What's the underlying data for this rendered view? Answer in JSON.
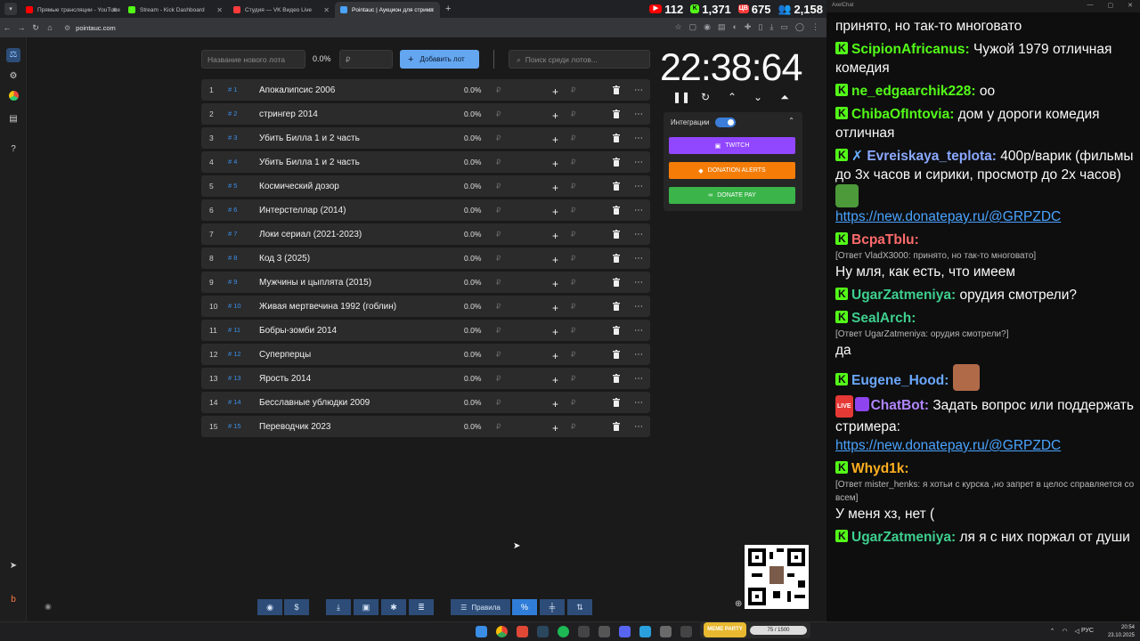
{
  "browser": {
    "tabs": [
      {
        "title": "Прямые трансляции - YouTube",
        "color": "#ff0000"
      },
      {
        "title": "Stream - Kick Dashboard",
        "color": "#53fc18"
      },
      {
        "title": "Студия — VK Видео Live",
        "color": "#ff3b3b"
      },
      {
        "title": "Pointauc | Аукцион для стрима",
        "color": "#4aa3ff"
      }
    ],
    "url": "pointauc.com",
    "viewer_stats": [
      {
        "platform": "youtube",
        "icon": "youtube-icon",
        "count": "112",
        "color": "#ff0000"
      },
      {
        "platform": "kick",
        "icon": "kick-icon",
        "count": "1,371",
        "color": "#53fc18"
      },
      {
        "platform": "vk",
        "icon": "vk-live-icon",
        "count": "675",
        "color": "#ff3b3b"
      },
      {
        "platform": "total",
        "icon": "users-icon",
        "count": "2,158",
        "color": "#4aa3ff"
      }
    ],
    "chat_window_title": "AxelChat"
  },
  "auction": {
    "new_lot_placeholder": "Название нового лота",
    "percent": "0.0%",
    "amount_placeholder": "₽",
    "add_label": "Добавить лот",
    "search_placeholder": "Поиск среди лотов...",
    "lots": [
      {
        "n": "1",
        "id": "# 1",
        "name": "Апокалипсис 2006",
        "pct": "0.0%"
      },
      {
        "n": "2",
        "id": "# 2",
        "name": "стрингер 2014",
        "pct": "0.0%"
      },
      {
        "n": "3",
        "id": "# 3",
        "name": "Убить Билла 1 и 2 часть",
        "pct": "0.0%"
      },
      {
        "n": "4",
        "id": "# 4",
        "name": "Убить Билла 1 и 2 часть",
        "pct": "0.0%"
      },
      {
        "n": "5",
        "id": "# 5",
        "name": "Космический дозор",
        "pct": "0.0%"
      },
      {
        "n": "6",
        "id": "# 6",
        "name": "Интерстеллар (2014)",
        "pct": "0.0%"
      },
      {
        "n": "7",
        "id": "# 7",
        "name": "Локи сериал (2021-2023)",
        "pct": "0.0%"
      },
      {
        "n": "8",
        "id": "# 8",
        "name": "Код 3 (2025)",
        "pct": "0.0%"
      },
      {
        "n": "9",
        "id": "# 9",
        "name": "Мужчины и цыплята (2015)",
        "pct": "0.0%"
      },
      {
        "n": "10",
        "id": "# 10",
        "name": "Живая мертвечина 1992 (гоблин)",
        "pct": "0.0%"
      },
      {
        "n": "11",
        "id": "# 11",
        "name": "Бобры-зомби 2014",
        "pct": "0.0%"
      },
      {
        "n": "12",
        "id": "# 12",
        "name": "Суперперцы",
        "pct": "0.0%"
      },
      {
        "n": "13",
        "id": "# 13",
        "name": "Ярость 2014",
        "pct": "0.0%"
      },
      {
        "n": "14",
        "id": "# 14",
        "name": "Бесславные ублюдки 2009",
        "pct": "0.0%"
      },
      {
        "n": "15",
        "id": "# 15",
        "name": "Переводчик 2023",
        "pct": "0.0%"
      }
    ],
    "currency_symbol": "₽",
    "timer": "22:38:64",
    "integrations": {
      "label": "Интеграции",
      "enabled": true,
      "buttons": [
        {
          "label": "TWITCH",
          "color": "#9147ff"
        },
        {
          "label": "DONATION ALERTS",
          "color": "#f57d07"
        },
        {
          "label": "DONATE PAY",
          "color": "#3bb54a"
        }
      ]
    },
    "rules_label": "Правила"
  },
  "chat": {
    "messages": [
      {
        "user": "",
        "reply": "",
        "text": "принято, но так-то многовато"
      },
      {
        "user": "ScipionAfricanus:",
        "color": "#53fc18",
        "reply": "",
        "text": "Чужой 1979 отличная комедия"
      },
      {
        "user": "ne_edgaarchik228:",
        "color": "#53fc18",
        "reply": "",
        "text": "оо"
      },
      {
        "user": "ChibaOfIntovia:",
        "color": "#53fc18",
        "reply": "",
        "text": "дом у дороги комедия отличная"
      },
      {
        "user": "Evreiskaya_teplota:",
        "color": "#8aa8ff",
        "reply": "",
        "text": "400р/варик (фильмы до 3х часов и сирики, просмотр до 2х часов)",
        "link": "https://new.donatepay.ru/@GRPZDC"
      },
      {
        "user": "BcpaTblu:",
        "color": "#ff6b6b",
        "reply": "[Ответ VladX3000: принято, но так-то многовато]",
        "text": "Ну мля, как есть, что имеем"
      },
      {
        "user": "UgarZatmeniya:",
        "color": "#3ecf8e",
        "reply": "",
        "text": "орудия смотрели?"
      },
      {
        "user": "SealArch:",
        "color": "#3ecf8e",
        "reply": "[Ответ UgarZatmeniya: орудия смотрели?]",
        "text": "да"
      },
      {
        "user": "Eugene_Hood:",
        "color": "#6aa8ff",
        "reply": "",
        "text": ""
      },
      {
        "user": "ChatBot:",
        "color": "#b085ff",
        "reply": "",
        "text": "Задать вопрос или поддержать стримера:",
        "link": "https://new.donatepay.ru/@GRPZDC"
      },
      {
        "user": "Whyd1k:",
        "color": "#ffb020",
        "reply": "[Ответ mister_henks: я хотьи с курска ,но запрет в целос справляется со всем]",
        "text": "У меня хз, нет ("
      },
      {
        "user": "UgarZatmeniya:",
        "color": "#3ecf8e",
        "reply": "",
        "text": "ля я с них поржал от души"
      }
    ]
  },
  "taskbar": {
    "meme_label": "MEME PARTY",
    "meme_progress": "75 / 1500",
    "lang": "РУС",
    "time": "20:54",
    "date": "23.10.2025"
  }
}
